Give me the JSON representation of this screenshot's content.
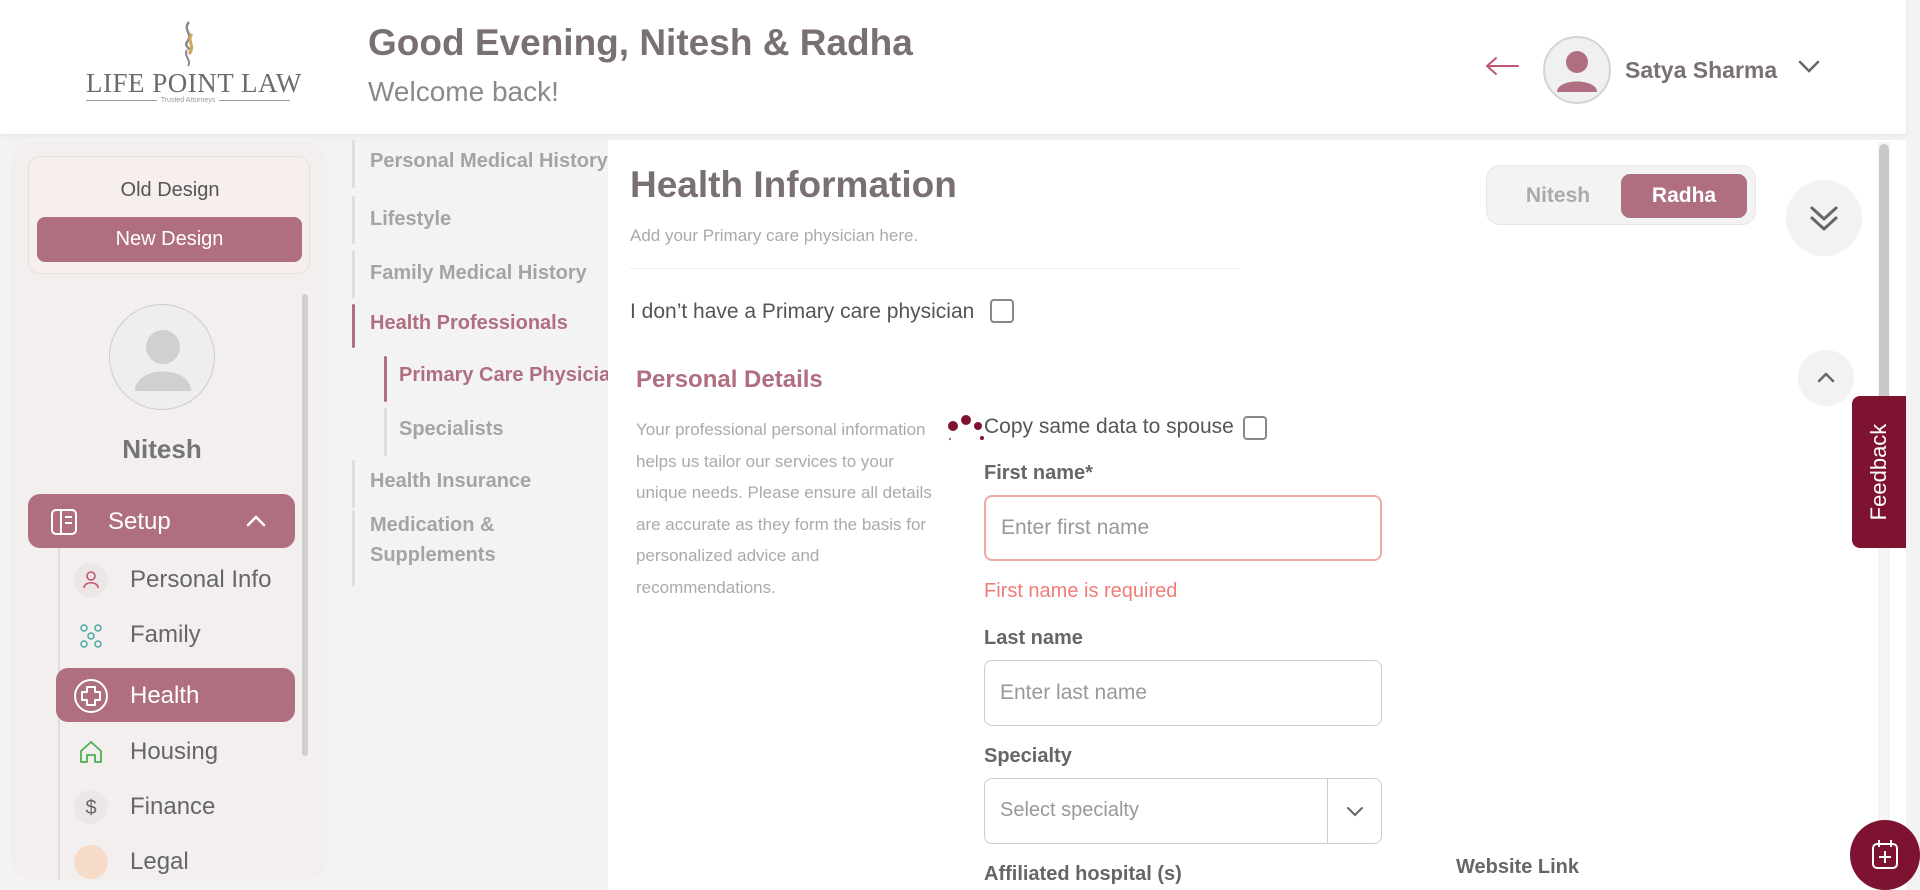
{
  "colors": {
    "accent": "#b06f80",
    "brand_dark": "#7d1330",
    "error": "#ef7d77"
  },
  "header": {
    "logo_text": "LIFE POINT LAW",
    "logo_tagline": "Trusted Attorneys",
    "greeting": "Good Evening, Nitesh & Radha",
    "welcome": "Welcome back!",
    "user_name": "Satya Sharma"
  },
  "sidebar": {
    "old_design": "Old Design",
    "new_design": "New Design",
    "profile_name": "Nitesh",
    "setup_label": "Setup",
    "items": [
      {
        "label": "Personal Info",
        "icon": "person-icon"
      },
      {
        "label": "Family",
        "icon": "family-icon"
      },
      {
        "label": "Health",
        "icon": "health-cross-icon"
      },
      {
        "label": "Housing",
        "icon": "house-icon"
      },
      {
        "label": "Finance",
        "icon": "dollar-icon"
      },
      {
        "label": "Legal",
        "icon": "legal-icon"
      }
    ]
  },
  "steps": {
    "items": [
      "Personal Medical History",
      "Lifestyle",
      "Family Medical History",
      "Health Professionals",
      "Primary Care Physician",
      "Specialists",
      "Health Insurance",
      "Medication &",
      "Supplements"
    ]
  },
  "main": {
    "title": "Health Information",
    "subtitle": "Add your Primary care physician here.",
    "no_pcp_label": "I don’t have a Primary care physician",
    "toggle": {
      "option1": "Nitesh",
      "option2": "Radha",
      "selected": "Radha"
    },
    "section_title": "Personal Details",
    "section_desc": "Your professional personal information helps us tailor our services to your unique needs. Please ensure all details are accurate as they form the basis for personalized advice and recommendations.",
    "copy_label": "Copy same data to spouse",
    "first_name_label": "First name*",
    "first_name_placeholder": "Enter first name",
    "first_name_error": "First name is required",
    "last_name_label": "Last name",
    "last_name_placeholder": "Enter last name",
    "specialty_label": "Specialty",
    "specialty_placeholder": "Select specialty",
    "hospital_label": "Affiliated hospital (s)",
    "website_label": "Website Link"
  },
  "feedback_label": "Feedback"
}
